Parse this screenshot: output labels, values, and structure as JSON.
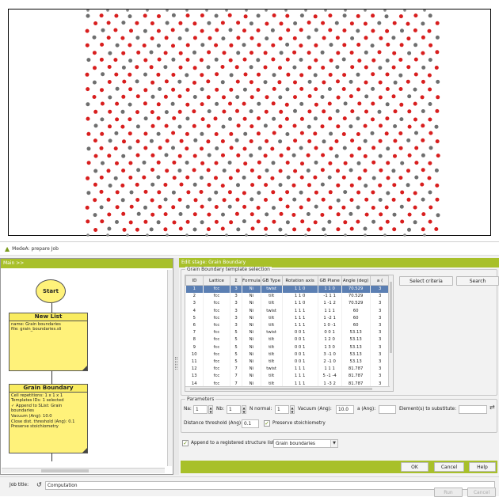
{
  "viewer": {
    "atom_colors": {
      "nickel_a": "#d81e1e",
      "nickel_b": "#6e6e6e",
      "boundary": "#111111"
    }
  },
  "window": {
    "title": "MedeA: prepare Job",
    "accent_color": "#a8c02a"
  },
  "flow": {
    "header": "Main >>",
    "start_label": "Start",
    "new_list": {
      "title": "New List",
      "lines": [
        "name: Grain boundaries",
        "file: grain_boundaries.sli"
      ]
    },
    "grain_boundary": {
      "title": "Grain Boundary",
      "lines": [
        "Cell repetitions: 1 x 1 x 1",
        "Templates IDs: 1 selected",
        "✓ Append to SList: Grain",
        "boundaries",
        "Vacuum (Ang): 10.0",
        "Close dist. threshold (Ang): 0.1",
        "Preserve stoichiometry"
      ]
    }
  },
  "stage": {
    "header": "Edit stage: Grain Boundary",
    "template_group": "Grain Boundary template selection",
    "columns": [
      "ID",
      "Lattice",
      "Σ",
      "Formula",
      "GB Type",
      "Rotation axis",
      "GB Plane",
      "Angle (deg)",
      "a ("
    ],
    "rows": [
      [
        "1",
        "fcc",
        "3",
        "Ni",
        "twist",
        "1 1 0",
        "1 1 0",
        "70.529",
        "3"
      ],
      [
        "2",
        "fcc",
        "3",
        "Ni",
        "tilt",
        "1 1 0",
        "-1 1 1",
        "70.529",
        "3"
      ],
      [
        "3",
        "fcc",
        "3",
        "Ni",
        "tilt",
        "1 1 0",
        "1 -1 2",
        "70.529",
        "3"
      ],
      [
        "4",
        "fcc",
        "3",
        "Ni",
        "twist",
        "1 1 1",
        "1 1 1",
        "60",
        "3"
      ],
      [
        "5",
        "fcc",
        "3",
        "Ni",
        "tilt",
        "1 1 1",
        "1 -2 1",
        "60",
        "3"
      ],
      [
        "6",
        "fcc",
        "3",
        "Ni",
        "tilt",
        "1 1 1",
        "1 0 -1",
        "60",
        "3"
      ],
      [
        "7",
        "fcc",
        "5",
        "Ni",
        "twist",
        "0 0 1",
        "0 0 1",
        "53.13",
        "3"
      ],
      [
        "8",
        "fcc",
        "5",
        "Ni",
        "tilt",
        "0 0 1",
        "1 2 0",
        "53.13",
        "3"
      ],
      [
        "9",
        "fcc",
        "5",
        "Ni",
        "tilt",
        "0 0 1",
        "1 3 0",
        "53.13",
        "3"
      ],
      [
        "10",
        "fcc",
        "5",
        "Ni",
        "tilt",
        "0 0 1",
        "3 -1 0",
        "53.13",
        "3"
      ],
      [
        "11",
        "fcc",
        "5",
        "Ni",
        "tilt",
        "0 0 1",
        "2 -1 0",
        "53.13",
        "3"
      ],
      [
        "12",
        "fcc",
        "7",
        "Ni",
        "twist",
        "1 1 1",
        "1 1 1",
        "81.787",
        "3"
      ],
      [
        "13",
        "fcc",
        "7",
        "Ni",
        "tilt",
        "1 1 1",
        "5 -1 -4",
        "81.787",
        "3"
      ],
      [
        "14",
        "fcc",
        "7",
        "Ni",
        "tilt",
        "1 1 1",
        "1 -3 2",
        "81.787",
        "3"
      ]
    ],
    "select_criteria": "Select criteria",
    "search": "Search",
    "params_group": "Parameters",
    "na_label": "Na:",
    "na_value": "1",
    "nb_label": "Nb:",
    "nb_value": "1",
    "nnormal_label": "N normal:",
    "nnormal_value": "1",
    "vacuum_label": "Vacuum (Ang):",
    "vacuum_value": "10.0",
    "a_label": "a (Ang):",
    "a_value": "",
    "element_label": "Element(s) to substitute:",
    "element_value": "",
    "distance_label": "Distance threshold (Ang):",
    "distance_value": "0.1",
    "preserve_label": "Preserve stoichiometry",
    "append_label": "Append to a registered structure list",
    "append_value": "Grain boundaries",
    "ok": "OK",
    "cancel": "Cancel",
    "help": "Help"
  },
  "job": {
    "title_label": "Job title:",
    "title_value": "Computation",
    "run": "Run",
    "cancel": "Cancel"
  }
}
